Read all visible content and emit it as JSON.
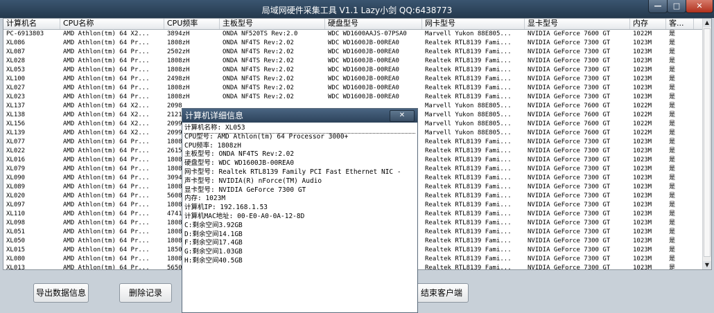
{
  "window": {
    "title": "局域网硬件采集工具 V1.1 Lazy小剑 QQ:6438773",
    "min": "—",
    "max": "□",
    "close": "✕"
  },
  "columns": [
    "计算机名",
    "CPU名称",
    "CPU频率",
    "主板型号",
    "硬盘型号",
    "网卡型号",
    "显卡型号",
    "内存",
    "客..."
  ],
  "rows": [
    [
      "PC-6913803",
      "AMD Athlon(tm) 64 X2...",
      "3894zH",
      "ONDA NF520TS Rev:2.0",
      "WDC WD1600AAJS-07PSA0",
      "Marvell Yukon 88E805...",
      "NVIDIA GeForce 7600 GT",
      "1022M",
      "是"
    ],
    [
      "XL086",
      "AMD Athlon(tm) 64 Pr...",
      "1808zH",
      "ONDA NF4TS Rev:2.02",
      "WDC WD1600JB-00REA0",
      "Realtek RTL8139 Fami...",
      "NVIDIA GeForce 7300 GT",
      "1023M",
      "是"
    ],
    [
      "XL087",
      "AMD Athlon(tm) 64 Pr...",
      "2502zH",
      "ONDA NF4TS Rev:2.02",
      "WDC WD1600JB-00REA0",
      "Realtek RTL8139 Fami...",
      "NVIDIA GeForce 7300 GT",
      "1023M",
      "是"
    ],
    [
      "XL028",
      "AMD Athlon(tm) 64 Pr...",
      "1808zH",
      "ONDA NF4TS Rev:2.02",
      "WDC WD1600JB-00REA0",
      "Realtek RTL8139 Fami...",
      "NVIDIA GeForce 7300 GT",
      "1023M",
      "是"
    ],
    [
      "XL053",
      "AMD Athlon(tm) 64 Pr...",
      "1808zH",
      "ONDA NF4TS Rev:2.02",
      "WDC WD1600JB-00REA0",
      "Realtek RTL8139 Fami...",
      "NVIDIA GeForce 7300 GT",
      "1023M",
      "是"
    ],
    [
      "XL100",
      "AMD Athlon(tm) 64 Pr...",
      "2498zH",
      "ONDA NF4TS Rev:2.02",
      "WDC WD1600JB-00REA0",
      "Realtek RTL8139 Fami...",
      "NVIDIA GeForce 7300 GT",
      "1023M",
      "是"
    ],
    [
      "XL027",
      "AMD Athlon(tm) 64 Pr...",
      "1808zH",
      "ONDA NF4TS Rev:2.02",
      "WDC WD1600JB-00REA0",
      "Realtek RTL8139 Fami...",
      "NVIDIA GeForce 7300 GT",
      "1023M",
      "是"
    ],
    [
      "XL023",
      "AMD Athlon(tm) 64 Pr...",
      "1808zH",
      "ONDA NF4TS Rev:2.02",
      "WDC WD1600JB-00REA0",
      "Realtek RTL8139 Fami...",
      "NVIDIA GeForce 7300 GT",
      "1023M",
      "是"
    ],
    [
      "XL137",
      "AMD Athlon(tm) 64 X2...",
      "2098",
      "",
      "",
      "Marvell Yukon 88E805...",
      "NVIDIA GeForce 7600 GT",
      "1022M",
      "是"
    ],
    [
      "XL138",
      "AMD Athlon(tm) 64 X2...",
      "2121",
      "",
      "",
      "Marvell Yukon 88E805...",
      "NVIDIA GeForce 7600 GT",
      "1022M",
      "是"
    ],
    [
      "XL156",
      "AMD Athlon(tm) 64 X2...",
      "2099",
      "",
      "",
      "Marvell Yukon 88E805...",
      "NVIDIA GeForce 7600 GT",
      "1022M",
      "是"
    ],
    [
      "XL139",
      "AMD Athlon(tm) 64 X2...",
      "2099",
      "",
      "",
      "Marvell Yukon 88E805...",
      "NVIDIA GeForce 7600 GT",
      "1022M",
      "是"
    ],
    [
      "XL077",
      "AMD Athlon(tm) 64 Pr...",
      "1808",
      "",
      "",
      "Realtek RTL8139 Fami...",
      "NVIDIA GeForce 7300 GT",
      "1023M",
      "是"
    ],
    [
      "XL022",
      "AMD Athlon(tm) 64 Pr...",
      "2615",
      "",
      "",
      "Realtek RTL8139 Fami...",
      "NVIDIA GeForce 7300 GT",
      "1023M",
      "是"
    ],
    [
      "XL016",
      "AMD Athlon(tm) 64 Pr...",
      "1808",
      "",
      "",
      "Realtek RTL8139 Fami...",
      "NVIDIA GeForce 7300 GT",
      "1023M",
      "是"
    ],
    [
      "XL079",
      "AMD Athlon(tm) 64 Pr...",
      "1808",
      "",
      "",
      "Realtek RTL8139 Fami...",
      "NVIDIA GeForce 7300 GT",
      "1023M",
      "是"
    ],
    [
      "XL090",
      "AMD Athlon(tm) 64 Pr...",
      "3094",
      "",
      "",
      "Realtek RTL8139 Fami...",
      "NVIDIA GeForce 7300 GT",
      "1023M",
      "是"
    ],
    [
      "XL089",
      "AMD Athlon(tm) 64 Pr...",
      "1808",
      "",
      "",
      "Realtek RTL8139 Fami...",
      "NVIDIA GeForce 7300 GT",
      "1023M",
      "是"
    ],
    [
      "XL020",
      "AMD Athlon(tm) 64 Pr...",
      "5608",
      "",
      "",
      "Realtek RTL8139 Fami...",
      "NVIDIA GeForce 7300 GT",
      "1023M",
      "是"
    ],
    [
      "XL097",
      "AMD Athlon(tm) 64 Pr...",
      "1808",
      "",
      "",
      "Realtek RTL8139 Fami...",
      "NVIDIA GeForce 7300 GT",
      "1023M",
      "是"
    ],
    [
      "XL110",
      "AMD Athlon(tm) 64 Pr...",
      "4741",
      "",
      "",
      "Realtek RTL8139 Fami...",
      "NVIDIA GeForce 7300 GT",
      "1023M",
      "是"
    ],
    [
      "XL098",
      "AMD Athlon(tm) 64 Pr...",
      "1808",
      "",
      "",
      "Realtek RTL8139 Fami...",
      "NVIDIA GeForce 7300 GT",
      "1023M",
      "是"
    ],
    [
      "XL051",
      "AMD Athlon(tm) 64 Pr...",
      "1808",
      "",
      "",
      "Realtek RTL8139 Fami...",
      "NVIDIA GeForce 7300 GT",
      "1023M",
      "是"
    ],
    [
      "XL050",
      "AMD Athlon(tm) 64 Pr...",
      "1808",
      "",
      "",
      "Realtek RTL8139 Fami...",
      "NVIDIA GeForce 7300 GT",
      "1023M",
      "是"
    ],
    [
      "XL015",
      "AMD Athlon(tm) 64 Pr...",
      "1850",
      "",
      "",
      "Realtek RTL8139 Fami...",
      "NVIDIA GeForce 7300 GT",
      "1023M",
      "是"
    ],
    [
      "XL080",
      "AMD Athlon(tm) 64 Pr...",
      "1808",
      "",
      "",
      "Realtek RTL8139 Fami...",
      "NVIDIA GeForce 7300 GT",
      "1023M",
      "是"
    ],
    [
      "XL013",
      "AMD Athlon(tm) 64 Pr...",
      "5650",
      "",
      "",
      "Realtek RTL8139 Fami...",
      "NVIDIA GeForce 7300 GT",
      "1023M",
      "是"
    ]
  ],
  "buttons": {
    "export": "导出数据信息",
    "delete": "删除记录",
    "end_client": "结束客户端"
  },
  "scroll": {
    "up": "▲",
    "down": "▼"
  },
  "dialog": {
    "title": "计算机详细信息",
    "close": "✕",
    "lines": [
      "计算机名称: XL053",
      "CPU型号: AMD Athlon(tm) 64 Processor 3000+",
      "CPU频率: 1808zH",
      "主板型号: ONDA NF4TS Rev:2.02",
      "硬盘型号: WDC WD1600JB-00REA0",
      "网卡型号: Realtek RTL8139 Family PCI Fast Ethernet NIC -",
      "声卡型号: NVIDIA(R) nForce(TM) Audio",
      "显卡型号: NVIDIA GeForce 7300 GT",
      "内存: 1023M",
      "计算机IP: 192.168.1.53",
      "计算机MAC地址: 00-E0-A0-0A-12-8D",
      "C:剩余空间3.92GB",
      "D:剩余空间14.1GB",
      "F:剩余空间17.4GB",
      "G:剩余空间1.03GB",
      "H:剩余空间40.5GB"
    ]
  },
  "colors": {
    "titlebar": "#2c425a",
    "close_button": "#b0301c",
    "background": "#c8d0d8"
  }
}
